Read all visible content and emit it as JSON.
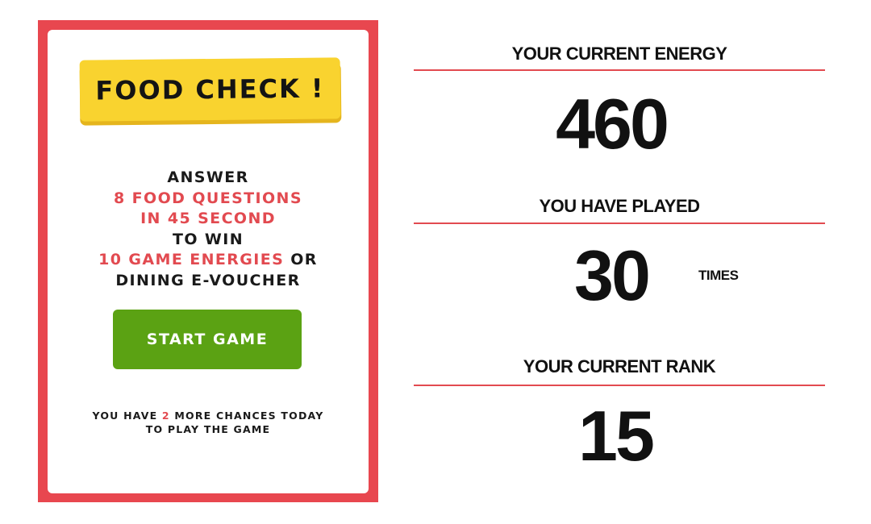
{
  "card": {
    "title": "FOOD CHECK !",
    "desc_answer": "ANSWER",
    "desc_questions": "8 FOOD QUESTIONS",
    "desc_time": "IN 45 SECOND",
    "desc_to_win": "TO WIN",
    "desc_energies": "10 GAME ENERGIES",
    "desc_or": " OR",
    "desc_voucher": "DINING E-VOUCHER",
    "start_button": "START GAME",
    "chances_prefix": "YOU HAVE ",
    "chances_count": "2",
    "chances_suffix": " MORE CHANCES TODAY",
    "chances_line2": "TO PLAY THE GAME"
  },
  "stats": {
    "energy_label": "YOUR CURRENT ENERGY",
    "energy_value": "460",
    "played_label": "YOU HAVE PLAYED",
    "played_value": "30",
    "played_unit": "TIMES",
    "rank_label": "YOUR CURRENT RANK",
    "rank_value": "15"
  },
  "colors": {
    "frame": "#e8474f",
    "accent_red": "#e24a50",
    "banner_yellow": "#f9d32f",
    "button_green": "#5ba213"
  }
}
